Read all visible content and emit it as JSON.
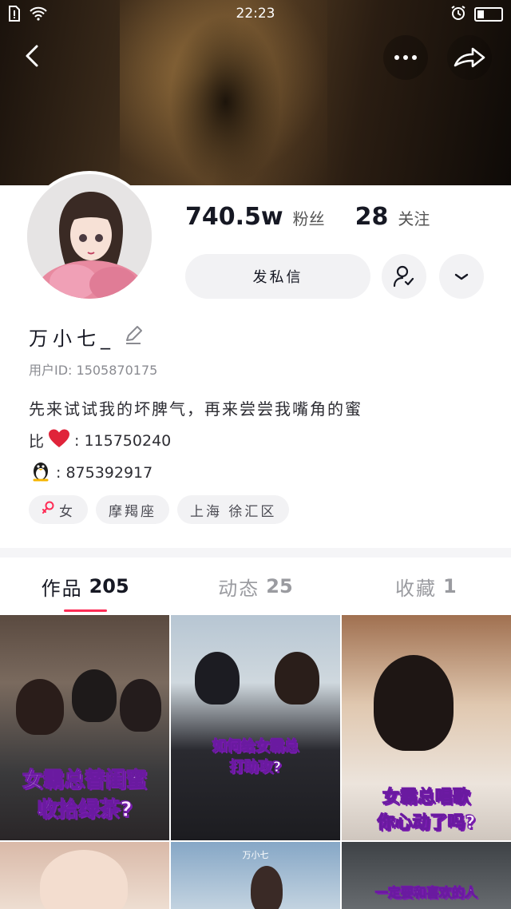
{
  "status_bar": {
    "time": "22:23"
  },
  "profile": {
    "followers_count": "740.5w",
    "followers_label": "粉丝",
    "following_count": "28",
    "following_label": "关注",
    "message_button": "发私信",
    "nickname": "万小七_",
    "user_id": "用户ID: 1505870175",
    "bio_line1": "先来试试我的坏脾气，再来尝尝我嘴角的蜜",
    "bio_line2_prefix": "比",
    "bio_line2_value": ": 115750240",
    "bio_line3_value": ": 875392917",
    "tags": [
      "女",
      "摩羯座",
      "上海 徐汇区"
    ]
  },
  "tabs": [
    {
      "label": "作品",
      "count": "205"
    },
    {
      "label": "动态",
      "count": "25"
    },
    {
      "label": "收藏",
      "count": "1"
    }
  ],
  "videos": [
    {
      "caption_line1": "女霸总替闺蜜",
      "caption_line2": "收拾绿茶?"
    },
    {
      "caption_line1": "如何给女霸总",
      "caption_line2": "打助攻?"
    },
    {
      "caption_line1": "女霸总唱歌",
      "caption_line2": "你心动了吗?"
    },
    {
      "caption_line1": "",
      "caption_line2": ""
    },
    {
      "caption_line1": "万小七",
      "caption_line2": ""
    },
    {
      "caption_line1": "一定要和喜欢的人",
      "caption_line2": ""
    }
  ],
  "colors": {
    "accent": "#fe2c55",
    "caption_stroke": "#7a1cb0"
  },
  "icons": [
    "sim-icon",
    "wifi-icon",
    "alarm-icon",
    "battery-icon",
    "back-icon",
    "more-icon",
    "share-icon",
    "follow-user-icon",
    "chevron-down-icon",
    "edit-icon",
    "heart-icon",
    "penguin-icon",
    "female-icon"
  ]
}
